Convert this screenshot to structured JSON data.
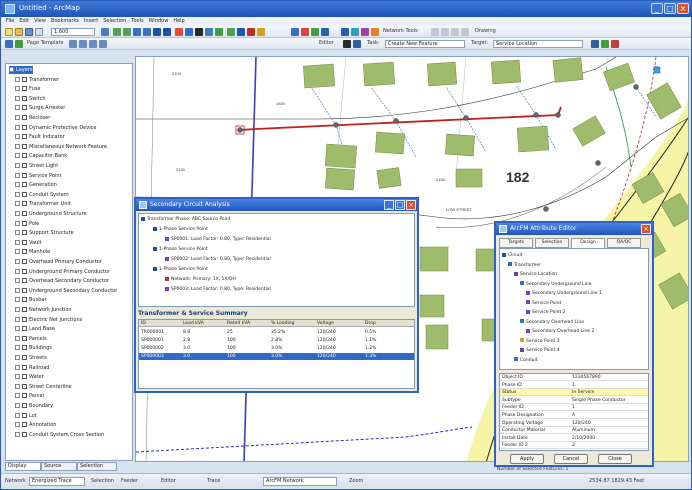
{
  "app": {
    "title": "Untitled - ArcMap",
    "menus": [
      "File",
      "Edit",
      "View",
      "Bookmarks",
      "Insert",
      "Selection",
      "Tools",
      "Window",
      "Help"
    ],
    "scale": "1:600",
    "editor_label": "Editor",
    "task_label": "Task:",
    "task_value": "Create New Feature",
    "target_label": "Target:",
    "target_value": "Service Location",
    "network_tools_label": "Network Tools",
    "page_template_label": "Page Template",
    "drawing_label": "Drawing"
  },
  "toc": {
    "items": [
      {
        "label": "Layers",
        "level": 0,
        "selected": true
      },
      {
        "label": "Transformer",
        "level": 1
      },
      {
        "label": "Fuse",
        "level": 1
      },
      {
        "label": "Switch",
        "level": 1
      },
      {
        "label": "Surge Arrester",
        "level": 1
      },
      {
        "label": "Recloser",
        "level": 1
      },
      {
        "label": "Dynamic Protective Device",
        "level": 1
      },
      {
        "label": "Fault Indicator",
        "level": 1
      },
      {
        "label": "Miscellaneous Network Feature",
        "level": 1
      },
      {
        "label": "Capacitor Bank",
        "level": 1
      },
      {
        "label": "Street Light",
        "level": 1
      },
      {
        "label": "Service Point",
        "level": 1
      },
      {
        "label": "Generation",
        "level": 1
      },
      {
        "label": "Conduit System",
        "level": 1
      },
      {
        "label": "Transformer Unit",
        "level": 1
      },
      {
        "label": "Underground Structure",
        "level": 1
      },
      {
        "label": "Pole",
        "level": 1
      },
      {
        "label": "Support Structure",
        "level": 1
      },
      {
        "label": "Vault",
        "level": 1
      },
      {
        "label": "Manhole",
        "level": 1
      },
      {
        "label": "Overhead Primary Conductor",
        "level": 1
      },
      {
        "label": "Underground Primary Conductor",
        "level": 1
      },
      {
        "label": "Overhead Secondary Conductor",
        "level": 1
      },
      {
        "label": "Underground Secondary Conductor",
        "level": 1
      },
      {
        "label": "Busbar",
        "level": 1
      },
      {
        "label": "Network Junction",
        "level": 1
      },
      {
        "label": "Electric Net Junctions",
        "level": 1
      },
      {
        "label": "Land Base",
        "level": 1
      },
      {
        "label": "Parcels",
        "level": 1
      },
      {
        "label": "Buildings",
        "level": 1
      },
      {
        "label": "Streets",
        "level": 1
      },
      {
        "label": "Railroad",
        "level": 1
      },
      {
        "label": "Water",
        "level": 1
      },
      {
        "label": "Street Centerline",
        "level": 1
      },
      {
        "label": "Parcel",
        "level": 1
      },
      {
        "label": "Boundary",
        "level": 1
      },
      {
        "label": "Lot",
        "level": 1
      },
      {
        "label": "Annotation",
        "level": 1
      },
      {
        "label": "Conduit System Cross Section",
        "level": 1
      }
    ],
    "tabs": [
      "Display",
      "Source",
      "Selection"
    ]
  },
  "map": {
    "labels": {
      "parcel_a": "182",
      "street": "LOW STREET",
      "lot1": "2104",
      "lot2": "1920",
      "lot3": "2130",
      "lot4": "2150"
    }
  },
  "circuit_dialog": {
    "title": "Secondary Circuit Analysis",
    "tree": [
      {
        "label": "Transformer Phase: ABC Source Point",
        "color": "#1f4fa0"
      },
      {
        "label": "1-Phase Service Point",
        "color": "#1f4fa0"
      },
      {
        "label": "SP0001: Load Factor: 0.80, Type: Residential",
        "color": "#7a3fbe"
      },
      {
        "label": "1-Phase Service Point",
        "color": "#1f4fa0"
      },
      {
        "label": "SP0002: Load Factor: 0.80, Type: Residential",
        "color": "#7a3fbe"
      },
      {
        "label": "1-Phase Service Point",
        "color": "#1f4fa0"
      },
      {
        "label": "Network: Primary: 1X, 1X/OH",
        "color": "#c03030"
      },
      {
        "label": "SP0003: Load Factor: 0.80, Type: Residential",
        "color": "#7a3fbe"
      }
    ],
    "summary_title": "Transformer & Service Summary",
    "summary_headers": [
      "ID",
      "Load kVA",
      "Rated kVA",
      "% Loading",
      "Voltage",
      "Drop"
    ],
    "summary_rows": [
      [
        "TR000001",
        "8.8",
        "25",
        "35.2%",
        "120/240",
        "0.5%"
      ],
      [
        "SP000001",
        "2.8",
        "100",
        "2.8%",
        "120/240",
        "1.1%"
      ],
      [
        "SP000002",
        "3.0",
        "100",
        "3.0%",
        "120/240",
        "1.2%"
      ],
      [
        "SP000003",
        "3.0",
        "100",
        "3.0%",
        "120/240",
        "1.3%"
      ]
    ],
    "selected_row": 3
  },
  "attr_dialog": {
    "title": "ArcFM Attribute Editor",
    "tabs": [
      "Targets",
      "Selection",
      "Design",
      "QA/QC"
    ],
    "active_tab": 2,
    "tree": [
      "Circuit",
      "Transformer",
      "Service Location",
      "Secondary Underground Line",
      "Secondary Underground Line 1",
      "Service Point",
      "Service Point 2",
      "Secondary Overhead Line",
      "Secondary Overhead Line 2",
      "Service Point 3",
      "Service Point 4",
      "Conduit"
    ],
    "attributes": [
      [
        "Object ID",
        "1234567890"
      ],
      [
        "Phase ID",
        "1"
      ],
      [
        "Status",
        "In Service"
      ],
      [
        "Subtype",
        "Single Phase Conductor"
      ],
      [
        "Feeder ID",
        "1"
      ],
      [
        "Phase Designation",
        "A"
      ],
      [
        "Operating Voltage",
        "120/240"
      ],
      [
        "Conductor Material",
        "Aluminum"
      ],
      [
        "Install Date",
        "2/10/2000"
      ],
      [
        "Feeder ID 2",
        "2"
      ]
    ],
    "buttons": [
      "Apply",
      "Cancel",
      "Close"
    ],
    "status": "Number of Selected Features: 1"
  },
  "statusbar": {
    "items": [
      "Network",
      "Selection",
      "Feeder",
      "Editor",
      "Trace",
      "Zoom"
    ],
    "dd1": "Energized Trace",
    "dd2": "ArcFM Network",
    "coords": "2534.87 1829.43 Feet"
  }
}
